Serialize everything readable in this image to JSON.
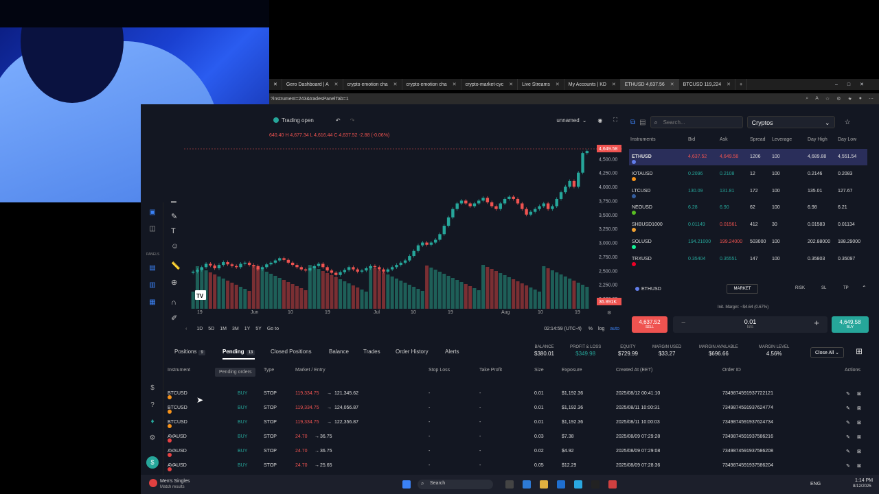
{
  "browser": {
    "tabs": [
      {
        "label": "Gero Dashboard | A",
        "active": false
      },
      {
        "label": "crypto emotion cha",
        "active": false
      },
      {
        "label": "crypto emotion cha",
        "active": false
      },
      {
        "label": "crypto-market-cyc",
        "active": false
      },
      {
        "label": "Live Streams",
        "active": false
      },
      {
        "label": "My Accounts | KD",
        "active": false
      },
      {
        "label": "ETHUSD 4,637.56",
        "active": true
      },
      {
        "label": "BTCUSD 119,224",
        "active": false
      }
    ],
    "url": "?instrument=243&tradesPanelTab=1"
  },
  "chart": {
    "status": "Trading open",
    "layout_name": "unnamed",
    "ohlc_text": "640.40 H 4,677.34 L 4,616.44 C 4,637.52 -2.88 (-0.06%)",
    "last_price_label": "4,649.58",
    "volume_label": "36.891K",
    "y_ticks": [
      "4,500.00",
      "4,250.00",
      "4,000.00",
      "3,750.00",
      "3,500.00",
      "3,250.00",
      "3,000.00",
      "2,750.00",
      "2,500.00",
      "2,250.00",
      "2,000.00"
    ],
    "x_ticks": [
      "19",
      "Jun",
      "10",
      "19",
      "Jul",
      "10",
      "19",
      "Aug",
      "10",
      "19"
    ],
    "timeframes": [
      "1D",
      "5D",
      "1M",
      "3M",
      "1Y",
      "5Y"
    ],
    "goto": "Go to",
    "clock": "02:14:59 (UTC-4)",
    "pct": "%",
    "log": "log",
    "auto": "auto"
  },
  "chart_data": {
    "type": "candlestick",
    "title": "",
    "ylim": [
      2000,
      4700
    ],
    "x_range": [
      "May 12",
      "Aug 12"
    ],
    "close": [
      2480,
      2510,
      2560,
      2620,
      2590,
      2540,
      2600,
      2650,
      2610,
      2580,
      2560,
      2620,
      2640,
      2600,
      2580,
      2520,
      2560,
      2610,
      2640,
      2680,
      2720,
      2690,
      2640,
      2600,
      2560,
      2520,
      2500,
      2540,
      2580,
      2620,
      2560,
      2500,
      2460,
      2420,
      2470,
      2510,
      2560,
      2520,
      2480,
      2500,
      2540,
      2580,
      2560,
      2520,
      2480,
      2520,
      2560,
      2600,
      2640,
      2680,
      2760,
      2850,
      2950,
      3000,
      2960,
      3000,
      3050,
      3150,
      3300,
      3450,
      3600,
      3700,
      3750,
      3700,
      3650,
      3700,
      3750,
      3800,
      3720,
      3650,
      3600,
      3700,
      3780,
      3820,
      3780,
      3700,
      3600,
      3500,
      3550,
      3600,
      3650,
      3700,
      3600,
      3650,
      3780,
      3900,
      4000,
      4100,
      4000,
      4250,
      4600,
      4637
    ],
    "last": 4637.52
  },
  "instruments_panel": {
    "search_placeholder": "Search...",
    "category": "Cryptos",
    "headers": [
      "Instruments",
      "Bid",
      "Ask",
      "Spread",
      "Leverage",
      "Day High",
      "Day Low"
    ],
    "rows": [
      {
        "symbol": "ETHUSD",
        "bid": "4,637.52",
        "ask": "4,649.58",
        "spread": "1206",
        "leverage": "100",
        "high": "4,689.88",
        "low": "4,551.54",
        "color": "#627eea",
        "bid_dir": "dn",
        "ask_dir": "dn"
      },
      {
        "symbol": "IOTAUSD",
        "bid": "0.2096",
        "ask": "0.2108",
        "spread": "12",
        "leverage": "100",
        "high": "0.2146",
        "low": "0.2083",
        "color": "#f7931a",
        "bid_dir": "up",
        "ask_dir": "up"
      },
      {
        "symbol": "LTCUSD",
        "bid": "130.09",
        "ask": "131.81",
        "spread": "172",
        "leverage": "100",
        "high": "135.01",
        "low": "127.67",
        "color": "#345d9d",
        "bid_dir": "up",
        "ask_dir": "up"
      },
      {
        "symbol": "NEOUSD",
        "bid": "6.28",
        "ask": "6.90",
        "spread": "62",
        "leverage": "100",
        "high": "6.98",
        "low": "6.21",
        "color": "#58be23",
        "bid_dir": "up",
        "ask_dir": "up"
      },
      {
        "symbol": "SHBUSD1000",
        "bid": "0.01149",
        "ask": "0.01561",
        "spread": "412",
        "leverage": "30",
        "high": "0.01583",
        "low": "0.01134",
        "color": "#f0a030",
        "bid_dir": "up",
        "ask_dir": "dn"
      },
      {
        "symbol": "SOLUSD",
        "bid": "194.21000",
        "ask": "199.24000",
        "spread": "503000",
        "leverage": "100",
        "high": "202.88000",
        "low": "188.29000",
        "color": "#14f195",
        "bid_dir": "up",
        "ask_dir": "dn"
      },
      {
        "symbol": "TRXUSD",
        "bid": "0.35404",
        "ask": "0.35551",
        "spread": "147",
        "leverage": "100",
        "high": "0.35803",
        "low": "0.35097",
        "color": "#ef0027",
        "bid_dir": "up",
        "ask_dir": "up"
      }
    ]
  },
  "order_panel": {
    "symbol": "ETHUSD",
    "order_type": "MARKET",
    "risk": "RISK",
    "sl": "SL",
    "tp": "TP",
    "margin": "Init. Margin: ~$4.64 (0.67%)",
    "sell_price": "4,637.52",
    "sell_label": "SELL",
    "buy_price": "4,649.58",
    "buy_label": "BUY",
    "lots": "0.01",
    "lots_label": "lots"
  },
  "trades_panel": {
    "tabs": [
      {
        "label": "Positions",
        "count": "9"
      },
      {
        "label": "Pending",
        "count": "13",
        "active": true
      },
      {
        "label": "Closed Positions",
        "count": ""
      },
      {
        "label": "Balance",
        "count": ""
      },
      {
        "label": "Trades",
        "count": ""
      },
      {
        "label": "Order History",
        "count": ""
      },
      {
        "label": "Alerts",
        "count": ""
      }
    ],
    "kpis": [
      {
        "label": "BALANCE",
        "value": "$380.01"
      },
      {
        "label": "PROFIT & LOSS",
        "value": "$349.98",
        "color": "#26a69a"
      },
      {
        "label": "EQUITY",
        "value": "$729.99"
      },
      {
        "label": "MARGIN USED",
        "value": "$33.27"
      },
      {
        "label": "MARGIN AVAILABLE",
        "value": "$696.66"
      },
      {
        "label": "MARGIN LEVEL",
        "value": "4.56%"
      }
    ],
    "close_all": "Close All",
    "tooltip": "Pending orders",
    "headers": [
      "Instrument",
      "Type",
      "Market / Entry",
      "Stop Loss",
      "Take Profit",
      "Size",
      "Exposure",
      "Created At (EET)",
      "Order ID",
      "Actions"
    ],
    "rows": [
      {
        "sym": "BTCUSD",
        "side": "BUY",
        "type": "STOP",
        "market": "119,334.75",
        "entry": "121,345.62",
        "sl": "-",
        "tp": "-",
        "size": "0.01",
        "exposure": "$1,192.36",
        "created": "2025/08/12 00:41:10",
        "id": "7349874591937722121"
      },
      {
        "sym": "BTCUSD",
        "side": "BUY",
        "type": "STOP",
        "market": "119,334.75",
        "entry": "124,056.87",
        "sl": "-",
        "tp": "-",
        "size": "0.01",
        "exposure": "$1,192.36",
        "created": "2025/08/11 10:00:31",
        "id": "7349874591937624774"
      },
      {
        "sym": "BTCUSD",
        "side": "BUY",
        "type": "STOP",
        "market": "119,334.75",
        "entry": "122,356.87",
        "sl": "-",
        "tp": "-",
        "size": "0.01",
        "exposure": "$1,192.36",
        "created": "2025/08/11 10:00:03",
        "id": "7349874591937624734"
      },
      {
        "sym": "AVAUSD",
        "side": "BUY",
        "type": "STOP",
        "market": "24.70",
        "entry": "36.75",
        "sl": "-",
        "tp": "-",
        "size": "0.03",
        "exposure": "$7.38",
        "created": "2025/08/09 07:29:28",
        "id": "7349874591937586216"
      },
      {
        "sym": "AVAUSD",
        "side": "BUY",
        "type": "STOP",
        "market": "24.70",
        "entry": "36.75",
        "sl": "-",
        "tp": "-",
        "size": "0.02",
        "exposure": "$4.92",
        "created": "2025/08/09 07:29:08",
        "id": "7349874591937586208"
      },
      {
        "sym": "AVAUSD",
        "side": "BUY",
        "type": "STOP",
        "market": "24.70",
        "entry": "25.65",
        "sl": "-",
        "tp": "-",
        "size": "0.05",
        "exposure": "$12.29",
        "created": "2025/08/09 07:28:36",
        "id": "7349874591937586204"
      }
    ]
  },
  "rail": {
    "panels": "PANELS"
  },
  "taskbar": {
    "music_title": "Men's Singles",
    "music_sub": "Match results",
    "search": "Search",
    "lang": "ENG",
    "time": "1:14 PM",
    "date": "8/12/2025"
  }
}
